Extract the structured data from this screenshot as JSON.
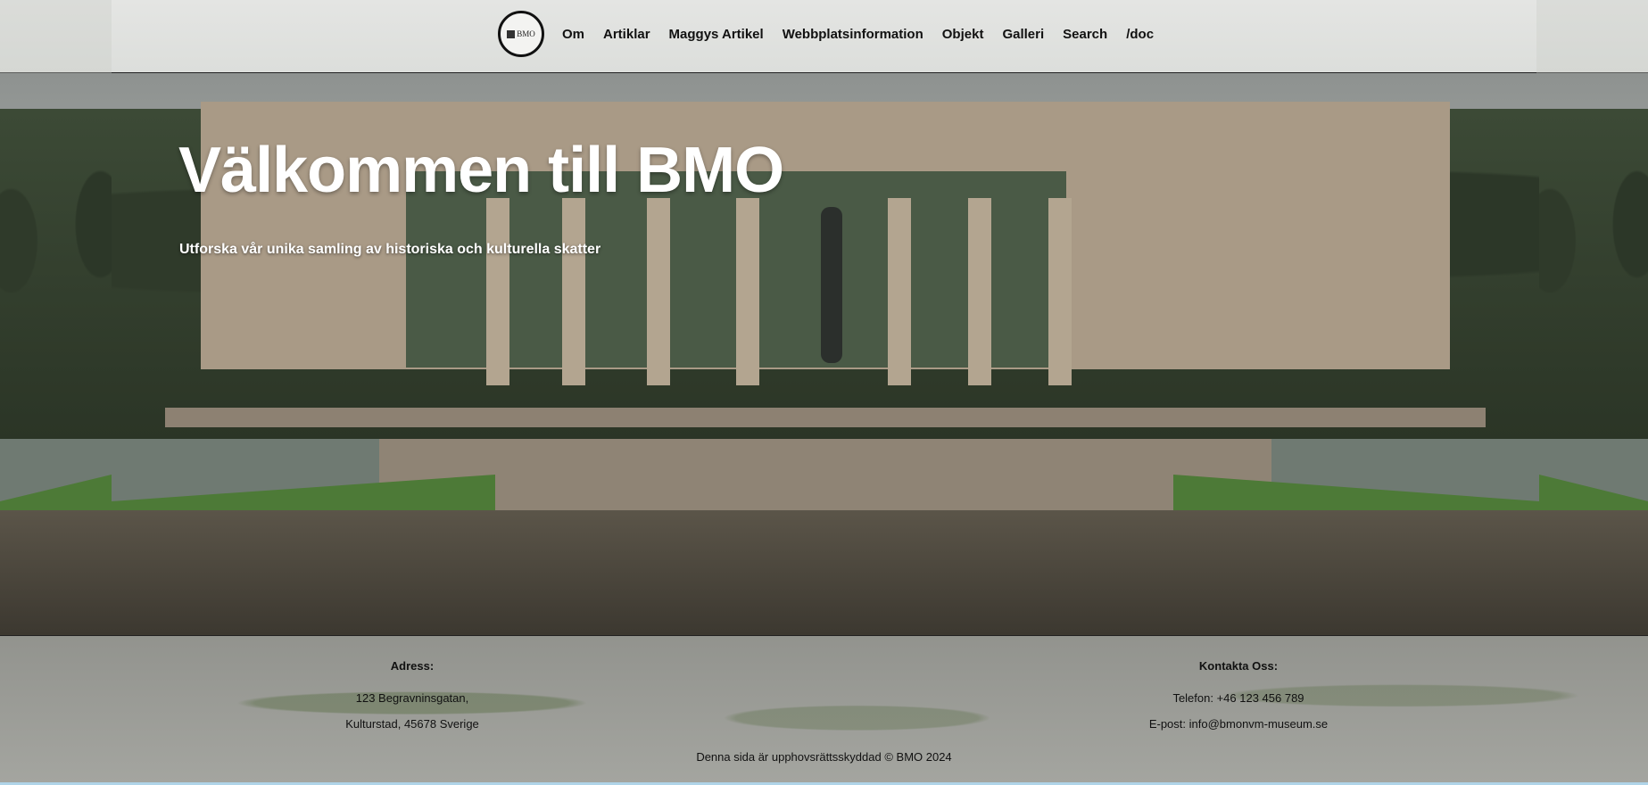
{
  "header": {
    "logo_text": "BMO",
    "nav": [
      "Om",
      "Artiklar",
      "Maggys Artikel",
      "Webbplatsinformation",
      "Objekt",
      "Galleri",
      "Search",
      "/doc"
    ]
  },
  "hero": {
    "title": "Välkommen till BMO",
    "subtitle": "Utforska vår unika samling av historiska och kulturella skatter"
  },
  "footer": {
    "address": {
      "heading": "Adress:",
      "line1": "123 Begravninsgatan,",
      "line2": "Kulturstad, 45678 Sverige"
    },
    "contact": {
      "heading": "Kontakta Oss:",
      "phone": "Telefon: +46 123 456 789",
      "email": "E-post: info@bmonvm-museum.se"
    },
    "copyright": "Denna sida är upphovsrättsskyddad © BMO 2024"
  },
  "colors": {
    "header_bg": "#e0e1df",
    "nav_text": "#111111",
    "hero_text": "#ffffff",
    "footer_bg": "#a5a5a0"
  }
}
